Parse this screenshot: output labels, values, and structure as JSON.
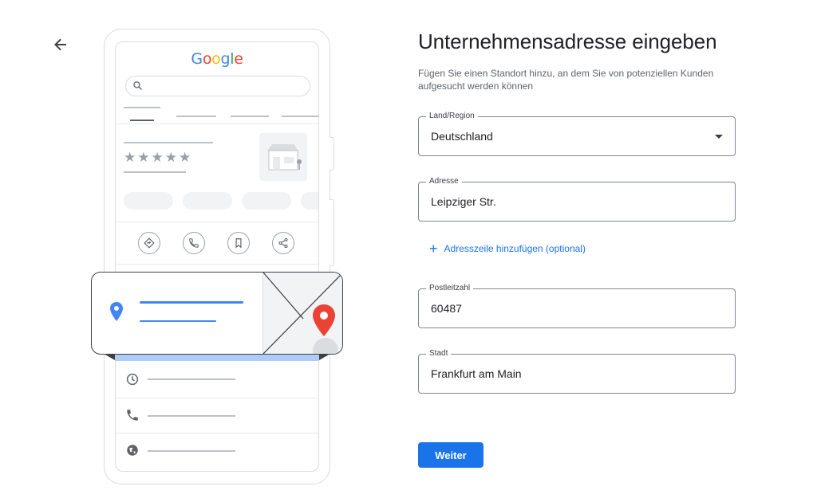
{
  "nav": {
    "back_icon": "arrow-left-icon"
  },
  "illustration": {
    "logo": {
      "letters": [
        "G",
        "o",
        "o",
        "g",
        "l",
        "e"
      ],
      "colors": [
        "#4285f4",
        "#ea4335",
        "#fbbc05",
        "#4285f4",
        "#34a853",
        "#ea4335"
      ]
    },
    "rating_stars": "★★★★★",
    "action_icons": [
      "directions-icon",
      "phone-icon",
      "bookmark-icon",
      "share-icon"
    ],
    "info_row_icons": [
      "clock-icon",
      "phone-icon",
      "globe-icon"
    ],
    "colors": {
      "pin_blue": "#4285f4",
      "pin_red": "#ea4335",
      "accent_bar": "#aecbfa"
    }
  },
  "form": {
    "title": "Unternehmensadresse eingeben",
    "subtitle": "Fügen Sie einen Standort hinzu, an dem Sie von potenziellen Kunden aufgesucht werden können",
    "country": {
      "label": "Land/Region",
      "value": "Deutschland"
    },
    "address": {
      "label": "Adresse",
      "value": "Leipziger Str."
    },
    "add_address_line": "Adresszeile hinzufügen (optional)",
    "postal_code": {
      "label": "Postleitzahl",
      "value": "60487"
    },
    "city": {
      "label": "Stadt",
      "value": "Frankfurt am Main"
    },
    "next_button": "Weiter"
  },
  "colors": {
    "primary": "#1a73e8",
    "text": "#202124",
    "secondary_text": "#5f6368"
  }
}
